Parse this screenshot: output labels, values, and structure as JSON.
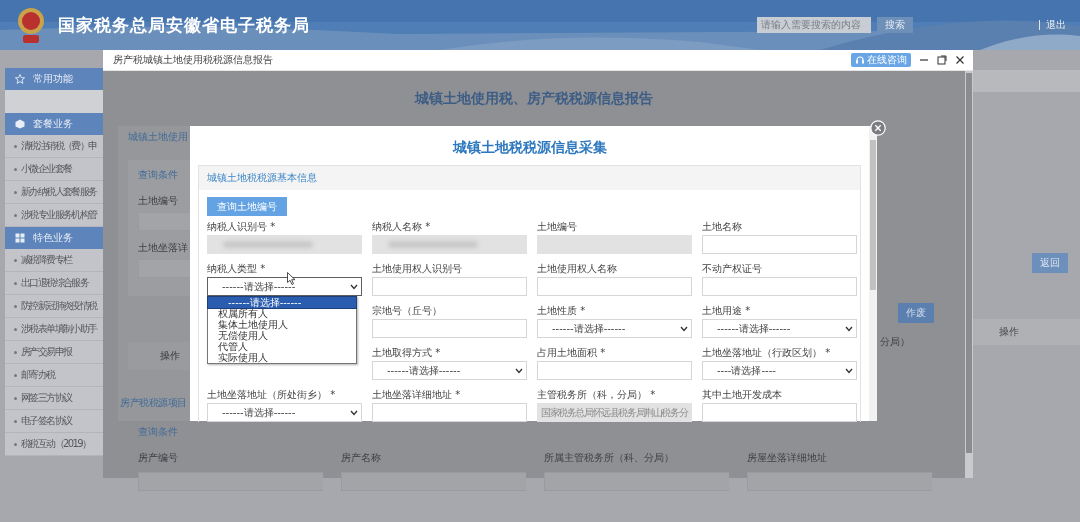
{
  "header": {
    "title": "国家税务总局安徽省电子税务局",
    "search": {
      "placeholder": "请输入需要搜索的内容"
    },
    "search_button": "搜索",
    "logout": "退出"
  },
  "sidebar": {
    "sections": [
      {
        "title": "常用功能",
        "kind": "star"
      },
      {
        "title": "套餐业务",
        "kind": "cube",
        "items": [
          "清税注销税（费）申",
          "小微企业套餐",
          "新办纳税人套餐服务",
          "涉税专业服务机构管"
        ]
      },
      {
        "title": "特色业务",
        "kind": "grid",
        "items": [
          "减税降费专栏",
          "出口退税综合服务",
          "防控新冠肺炎疫情税",
          "涉税表单填制小助手",
          "房产交易申报",
          "邮寄办税",
          "网签三方协议",
          "电子签名协议",
          "税税互动（2019）"
        ]
      }
    ]
  },
  "page": {
    "return_button": "返回",
    "table_header": "操作"
  },
  "dialog": {
    "title": "房产税城镇土地使用税税源信息报告",
    "help_button": "在线咨询",
    "heading": "城镇土地使用税、房产税税源信息报告",
    "land_panel": {
      "title": "城镇土地使用",
      "query_title": "查询条件",
      "fields": [
        "土地编号",
        "土地坐落详"
      ],
      "table_header": "操作",
      "void_button": "作废",
      "column_header": "分局）"
    },
    "house_panel": {
      "title": "房产税税源项目",
      "query_title": "查询条件",
      "fields": [
        "房产编号",
        "房产名称",
        "所属主管税务所（科、分局）",
        "房屋坐落详细地址"
      ]
    }
  },
  "form": {
    "title": "城镇土地税税源信息采集",
    "section": "城镇土地税税源基本信息",
    "query_button": "查询土地编号",
    "fields": [
      {
        "label": "纳税人识别号 *",
        "kind": "redacted",
        "disabled": true
      },
      {
        "label": "纳税人名称 *",
        "kind": "redacted",
        "disabled": true
      },
      {
        "label": "土地编号",
        "kind": "input",
        "disabled": true
      },
      {
        "label": "土地名称",
        "kind": "input",
        "disabled": false
      },
      {
        "label": "纳税人类型 *",
        "kind": "select",
        "disabled": false,
        "value": "------请选择------",
        "open": true,
        "options": [
          {
            "label": "------请选择------",
            "selected": true
          },
          {
            "label": "权属所有人",
            "selected": false
          },
          {
            "label": "集体土地使用人",
            "selected": false
          },
          {
            "label": "无偿使用人",
            "selected": false
          },
          {
            "label": "代管人",
            "selected": false
          },
          {
            "label": "实际使用人",
            "selected": false
          }
        ]
      },
      {
        "label": "土地使用权人识别号",
        "kind": "input",
        "disabled": false
      },
      {
        "label": "土地使用权人名称",
        "kind": "input",
        "disabled": false
      },
      {
        "label": "不动产权证号",
        "kind": "input",
        "disabled": false
      },
      {
        "kind": "covered"
      },
      {
        "label": "宗地号（丘号）",
        "kind": "input",
        "disabled": false
      },
      {
        "label": "土地性质 *",
        "kind": "select",
        "disabled": false,
        "value": "------请选择------",
        "open": false
      },
      {
        "label": "土地用途 *",
        "kind": "select",
        "disabled": false,
        "value": "------请选择------",
        "open": false
      },
      {
        "kind": "covered"
      },
      {
        "label": "土地取得方式 *",
        "kind": "select",
        "disabled": false,
        "value": "------请选择------",
        "open": false
      },
      {
        "label": "占用土地面积 *",
        "kind": "input",
        "disabled": false
      },
      {
        "label": "土地坐落地址（行政区划） *",
        "kind": "select",
        "disabled": false,
        "value": "----请选择----",
        "open": false
      },
      {
        "label": "土地坐落地址（所处街乡） *",
        "kind": "select",
        "disabled": false,
        "value": "------请选择------",
        "open": false
      },
      {
        "label": "土地坐落详细地址 *",
        "kind": "input",
        "disabled": false
      },
      {
        "label": "主管税务所（科，分局） *",
        "kind": "input",
        "disabled": true,
        "value": "国家税务总局怀远县税务局荆山税务分"
      },
      {
        "label": "其中土地开发成本",
        "kind": "input",
        "disabled": false
      }
    ]
  }
}
